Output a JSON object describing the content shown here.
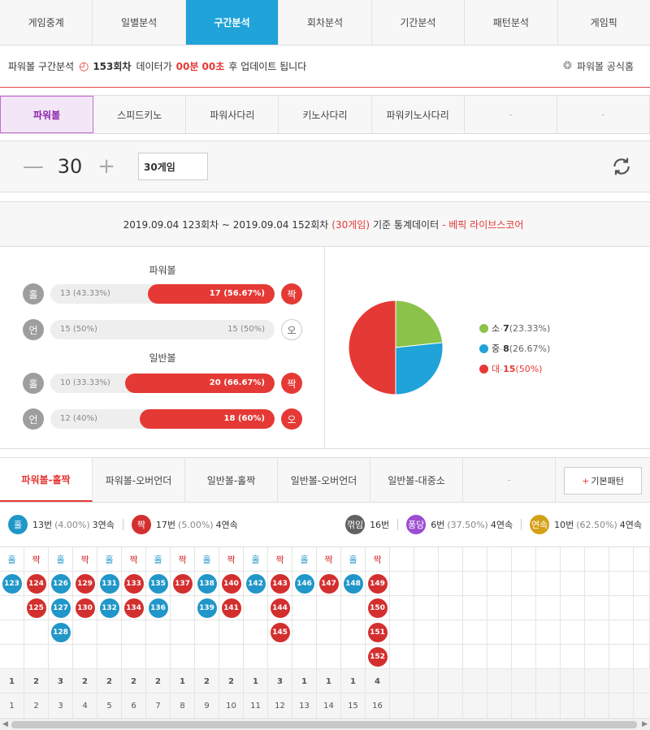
{
  "topnav": [
    "게임중계",
    "일별분석",
    "구간분석",
    "회차분석",
    "기간분석",
    "패턴분석",
    "게임픽"
  ],
  "topnav_active": 2,
  "info": {
    "prefix": "파워볼 구간분석",
    "round": "153회차",
    "mid": "데이터가",
    "time": "00분 00초",
    "suffix": "후 업데이트 됩니다",
    "official": "파워볼 공식홈"
  },
  "gametabs": [
    "파워볼",
    "스피드키노",
    "파워사다리",
    "키노사다리",
    "파워키노사다리",
    "-",
    "-"
  ],
  "counter": {
    "minus": "—",
    "value": "30",
    "plus": "+",
    "select": "30게임"
  },
  "statshead": {
    "text": "2019.09.04 123회차 ~ 2019.09.04 152회차",
    "games": "(30게임)",
    "mid": "기준 통계데이터",
    "brand": "- 베픽 라이브스코어"
  },
  "powerball": {
    "title": "파워볼",
    "rows": [
      {
        "left_ball": "홀",
        "left_text": "13 (43.33%)",
        "right_text": "17 (56.67%)",
        "right_ball": "짝",
        "right_pct": 56.67,
        "right_red": true
      },
      {
        "left_ball": "언",
        "left_text": "15 (50%)",
        "right_text": "15 (50%)",
        "right_ball": "오",
        "right_pct": 0,
        "right_red": false
      }
    ]
  },
  "normalball": {
    "title": "일반볼",
    "rows": [
      {
        "left_ball": "홀",
        "left_text": "10 (33.33%)",
        "right_text": "20 (66.67%)",
        "right_ball": "짝",
        "right_pct": 66.67,
        "right_red": true
      },
      {
        "left_ball": "언",
        "left_text": "12 (40%)",
        "right_text": "18 (60%)",
        "right_ball": "오",
        "right_pct": 60,
        "right_red": true
      }
    ]
  },
  "chart_data": {
    "type": "pie",
    "slices": [
      {
        "label": "소",
        "count": "7",
        "pct": "(23.33%)",
        "value": 23.33,
        "color": "#8bc34a"
      },
      {
        "label": "중",
        "count": "8",
        "pct": "(26.67%)",
        "value": 26.67,
        "color": "#1fa3d8"
      },
      {
        "label": "대",
        "count": "15",
        "pct": "(50%)",
        "value": 50,
        "color": "#e53935"
      }
    ]
  },
  "pattabs": [
    "파워볼-홀짝",
    "파워볼-오버언더",
    "일반볼-홀짝",
    "일반볼-오버언더",
    "일반볼-대중소",
    "-"
  ],
  "basic_pattern": "기본패턴",
  "summary": {
    "odd_ball": "홀",
    "odd_text": "13번",
    "odd_pct": "(4.00%)",
    "odd_streak": "3연속",
    "even_ball": "짝",
    "even_text": "17번",
    "even_pct": "(5.00%)",
    "even_streak": "4연속",
    "break_ball": "꺾임",
    "break_text": "16번",
    "pong_ball": "퐁당",
    "pong_text": "6번",
    "pong_pct": "(37.50%)",
    "pong_streak": "4연속",
    "cont_ball": "연속",
    "cont_text": "10번",
    "cont_pct": "(62.50%)",
    "cont_streak": "4연속"
  },
  "pattern_columns": [
    {
      "h": "홀",
      "c": "blue",
      "v": [
        "123"
      ]
    },
    {
      "h": "짝",
      "c": "red",
      "v": [
        "124",
        "125"
      ]
    },
    {
      "h": "홀",
      "c": "blue",
      "v": [
        "126",
        "127",
        "128"
      ]
    },
    {
      "h": "짝",
      "c": "red",
      "v": [
        "129",
        "130"
      ]
    },
    {
      "h": "홀",
      "c": "blue",
      "v": [
        "131",
        "132"
      ]
    },
    {
      "h": "짝",
      "c": "red",
      "v": [
        "133",
        "134"
      ]
    },
    {
      "h": "홀",
      "c": "blue",
      "v": [
        "135",
        "136"
      ]
    },
    {
      "h": "짝",
      "c": "red",
      "v": [
        "137"
      ]
    },
    {
      "h": "홀",
      "c": "blue",
      "v": [
        "138",
        "139"
      ]
    },
    {
      "h": "짝",
      "c": "red",
      "v": [
        "140",
        "141"
      ]
    },
    {
      "h": "홀",
      "c": "blue",
      "v": [
        "142"
      ]
    },
    {
      "h": "짝",
      "c": "red",
      "v": [
        "143",
        "144",
        "145"
      ]
    },
    {
      "h": "홀",
      "c": "blue",
      "v": [
        "146"
      ]
    },
    {
      "h": "짝",
      "c": "red",
      "v": [
        "147"
      ]
    },
    {
      "h": "홀",
      "c": "blue",
      "v": [
        "148"
      ]
    },
    {
      "h": "짝",
      "c": "red",
      "v": [
        "149",
        "150",
        "151",
        "152"
      ]
    }
  ],
  "col_counts": [
    "1",
    "2",
    "3",
    "2",
    "2",
    "2",
    "2",
    "1",
    "2",
    "2",
    "1",
    "3",
    "1",
    "1",
    "1",
    "4"
  ],
  "col_index": [
    "1",
    "2",
    "3",
    "4",
    "5",
    "6",
    "7",
    "8",
    "9",
    "10",
    "11",
    "12",
    "13",
    "14",
    "15",
    "16"
  ],
  "colors": {
    "blue": "#2196c9",
    "red": "#d32f2f",
    "accent": "#1fa3d8",
    "purple": "#8e24aa"
  }
}
